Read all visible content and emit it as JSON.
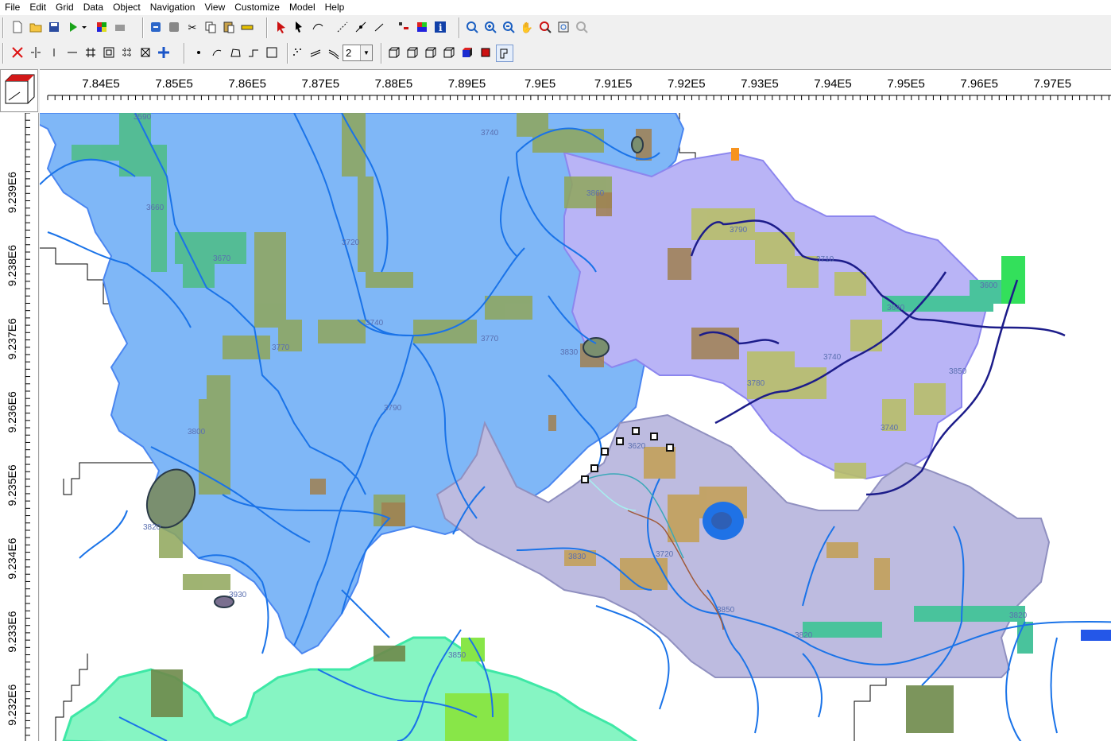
{
  "menu": [
    "File",
    "Edit",
    "Grid",
    "Data",
    "Object",
    "Navigation",
    "View",
    "Customize",
    "Model",
    "Help"
  ],
  "toolbar": {
    "lines_value": "2"
  },
  "colors": {
    "basin_blue": "#7fb7f7",
    "basin_lavender": "#b9b4f6",
    "basin_grey": "#bdbbe0",
    "basin_green": "#86f5c3",
    "stream": "#1a73e8",
    "stream_dark": "#1c1c8a",
    "grid_outline": "#000000"
  },
  "x_axis_ticks": [
    "7.84E5",
    "7.85E5",
    "7.86E5",
    "7.87E5",
    "7.88E5",
    "7.89E5",
    "7.9E5",
    "7.91E5",
    "7.92E5",
    "7.93E5",
    "7.94E5",
    "7.95E5",
    "7.96E5",
    "7.97E5"
  ],
  "y_axis_ticks": [
    "9.239E6",
    "9.238E6",
    "9.237E6",
    "9.236E6",
    "9.235E6",
    "9.234E6",
    "9.233E6",
    "9.232E6"
  ],
  "contour_labels": [
    "3590",
    "3740",
    "3860",
    "3660",
    "3720",
    "3670",
    "3740",
    "3770",
    "3770",
    "3830",
    "3790",
    "3800",
    "3820",
    "3930",
    "3850",
    "3600",
    "3790",
    "3710",
    "3640",
    "3740",
    "3780",
    "3850",
    "3740",
    "3620",
    "3830",
    "3720",
    "3850",
    "3820",
    "3820"
  ]
}
